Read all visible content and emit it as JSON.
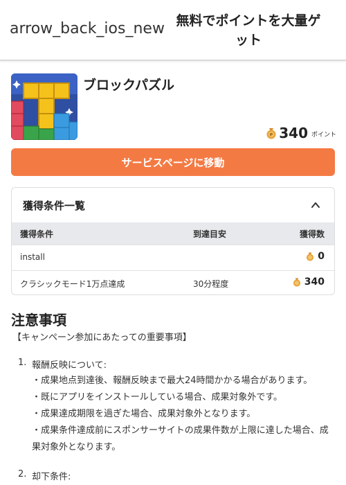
{
  "header": {
    "back_icon_text": "arrow_back_ios_new",
    "title": "無料でポイントを大量ゲット"
  },
  "app": {
    "name": "ブロックパズル",
    "icon": "block-puzzle-app-icon",
    "points_value": "340",
    "points_unit": "ポイント",
    "coin_icon": "coin-bag-icon"
  },
  "cta": {
    "label": "サービスページに移動"
  },
  "conditions": {
    "title": "獲得条件一覧",
    "headers": {
      "condition": "獲得条件",
      "target": "到達目安",
      "reward": "獲得数"
    },
    "rows": [
      {
        "condition": "install",
        "target": "",
        "reward": "0"
      },
      {
        "condition": "クラシックモード1万点達成",
        "target": "30分程度",
        "reward": "340"
      }
    ]
  },
  "notes": {
    "title": "注意事項",
    "intro": "【キャンペーン参加にあたっての重要事項】",
    "items": [
      {
        "num": "1.",
        "heading": "報酬反映について:",
        "bullets": [
          "・成果地点到達後、報酬反映まで最大24時間かかる場合があります。",
          "・既にアプリをインストールしている場合、成果対象外です。",
          "・成果達成期限を過ぎた場合、成果対象外となります。",
          "・成果条件達成前にスポンサーサイトの成果件数が上限に達した場合、成果対象外となります。"
        ]
      },
      {
        "num": "2.",
        "heading": "却下条件:",
        "bullets": []
      }
    ]
  },
  "colors": {
    "accent": "#f47a44",
    "table_header_bg": "#e7e9ec",
    "coin": "#e8a33a"
  }
}
